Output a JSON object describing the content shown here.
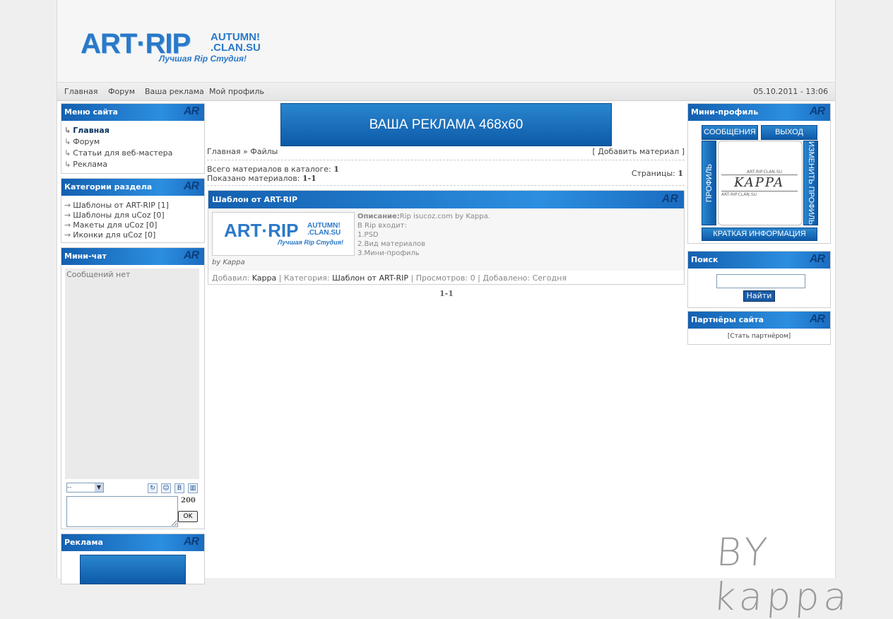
{
  "site": {
    "logo_main": "ART·RIP",
    "logo_side1": "AUTUMN!",
    "logo_side2": ".CLAN.SU",
    "logo_slogan": "Лучшая Rip Студия!"
  },
  "topnav": {
    "items": [
      "Главная",
      "Форум",
      "Ваша реклама",
      "Мой профиль"
    ],
    "datetime": "05.10.2011 - 13:06"
  },
  "left": {
    "menu_title": "Меню сайта",
    "menu_items": [
      "Главная",
      "Форум",
      "Статьи для веб-мастера",
      "Реклама"
    ],
    "categories_title": "Категории раздела",
    "categories": [
      "Шаблоны от ART-RIP [1]",
      "Шаблоны для uCoz [0]",
      "Макеты для uCoz [0]",
      "Иконки для uCoz [0]"
    ],
    "minichat_title": "Мини-чат",
    "minichat_empty": "Сообщений нет",
    "minichat_select": "--",
    "minichat_count": "200",
    "minichat_ok": "OK",
    "ads_title": "Реклама",
    "ar_badge": "AR"
  },
  "center": {
    "banner": "ВАША РЕКЛАМА 468x60",
    "breadcrumb_home": "Главная",
    "breadcrumb_sep": "»",
    "breadcrumb_files": "Файлы",
    "add_material": "[ Добавить материал ]",
    "total_label": "Всего материалов в каталоге:",
    "total_value": "1",
    "shown_label": "Показано материалов:",
    "shown_value": "1-1",
    "pages_label": "Страницы:",
    "pages_value": "1",
    "material": {
      "title": "Шаблон от ART-RIP",
      "byline": "by Kappa",
      "desc_label": "Описание:",
      "desc_text": "Rip isucoz.com by Kappa.",
      "desc_lines": [
        "В Rip входит:",
        "1.PSD",
        "2.Вид материалов",
        "3.Мини-профиль"
      ],
      "foot_added_label": "Добавил:",
      "foot_added_value": "Kappa",
      "foot_cat_label": "Категория:",
      "foot_cat_value": "Шаблон от ART-RIP",
      "foot_views": "Просмотров: 0",
      "foot_date": "Добавлено: Сегодня"
    },
    "bottom_pages": "1-1"
  },
  "right": {
    "profile_title": "Мини-профиль",
    "btn_messages": "СООБЩЕНИЯ",
    "btn_logout": "ВЫХОД",
    "btn_profile": "ПРОФИЛЬ",
    "btn_edit_profile": "ИЗМЕНИТЬ ПРОФИЛЬ",
    "btn_info": "КРАТКАЯ ИНФОРМАЦИЯ",
    "avatar_name": "KAPPA",
    "avatar_url1": "ART-RIP.CLAN.SU",
    "avatar_url2": "ART-RIP.CLAN.SU",
    "search_title": "Поиск",
    "search_btn": "Найти",
    "partners_title": "Партнёры сайта",
    "partners_link": "[Стать партнёром]"
  },
  "signature": "BY kappa"
}
